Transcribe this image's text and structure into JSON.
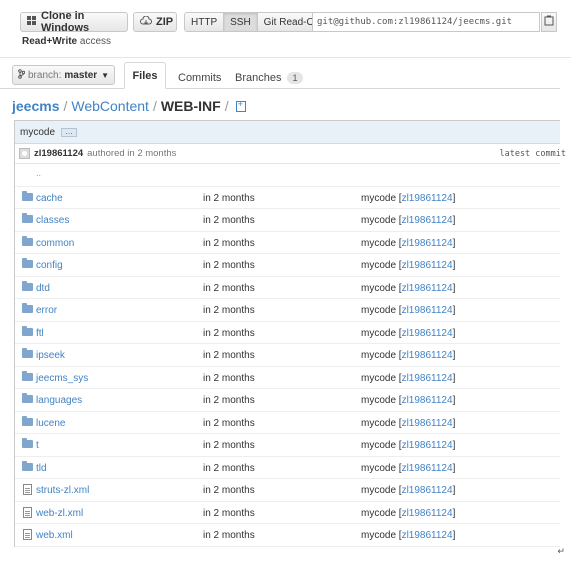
{
  "clone": {
    "clone_windows_label": "Clone in Windows",
    "zip_label": "ZIP",
    "protocols": [
      "HTTP",
      "SSH",
      "Git Read-Only"
    ],
    "active_protocol": "SSH",
    "url": "git@github.com:zl19861124/jeecms.git",
    "access_strong": "Read+Write",
    "access_rest": " access"
  },
  "tabs": {
    "branch_label": "branch:",
    "branch_value": "master",
    "files": "Files",
    "commits": "Commits",
    "branches": "Branches",
    "branches_count": "1"
  },
  "breadcrumb": {
    "repo": "jeecms",
    "sep": "/",
    "folder": "WebContent",
    "current": "WEB-INF"
  },
  "commit": {
    "title": "mycode",
    "dots": "…",
    "author": "zl19861124",
    "authored_text": "authored in 2 months",
    "latest": "latest commit"
  },
  "parent_dir": "..",
  "files": [
    {
      "name": "cache",
      "type": "dir",
      "age": "in 2 months",
      "message": "mycode",
      "committer": "zl19861124"
    },
    {
      "name": "classes",
      "type": "dir",
      "age": "in 2 months",
      "message": "mycode",
      "committer": "zl19861124"
    },
    {
      "name": "common",
      "type": "dir",
      "age": "in 2 months",
      "message": "mycode",
      "committer": "zl19861124"
    },
    {
      "name": "config",
      "type": "dir",
      "age": "in 2 months",
      "message": "mycode",
      "committer": "zl19861124"
    },
    {
      "name": "dtd",
      "type": "dir",
      "age": "in 2 months",
      "message": "mycode",
      "committer": "zl19861124"
    },
    {
      "name": "error",
      "type": "dir",
      "age": "in 2 months",
      "message": "mycode",
      "committer": "zl19861124"
    },
    {
      "name": "ftl",
      "type": "dir",
      "age": "in 2 months",
      "message": "mycode",
      "committer": "zl19861124"
    },
    {
      "name": "ipseek",
      "type": "dir",
      "age": "in 2 months",
      "message": "mycode",
      "committer": "zl19861124"
    },
    {
      "name": "jeecms_sys",
      "type": "dir",
      "age": "in 2 months",
      "message": "mycode",
      "committer": "zl19861124"
    },
    {
      "name": "languages",
      "type": "dir",
      "age": "in 2 months",
      "message": "mycode",
      "committer": "zl19861124"
    },
    {
      "name": "lucene",
      "type": "dir",
      "age": "in 2 months",
      "message": "mycode",
      "committer": "zl19861124"
    },
    {
      "name": "t",
      "type": "dir",
      "age": "in 2 months",
      "message": "mycode",
      "committer": "zl19861124"
    },
    {
      "name": "tld",
      "type": "dir",
      "age": "in 2 months",
      "message": "mycode",
      "committer": "zl19861124"
    },
    {
      "name": "struts-zl.xml",
      "type": "file",
      "age": "in 2 months",
      "message": "mycode",
      "committer": "zl19861124"
    },
    {
      "name": "web-zl.xml",
      "type": "file",
      "age": "in 2 months",
      "message": "mycode",
      "committer": "zl19861124"
    },
    {
      "name": "web.xml",
      "type": "file",
      "age": "in 2 months",
      "message": "mycode",
      "committer": "zl19861124"
    }
  ],
  "icons": {
    "clone": "windows-icon",
    "zip": "cloud-download-icon",
    "copy": "clipboard-icon",
    "branch": "branch-icon",
    "new_file": "new-file-icon",
    "dir": "folder-icon",
    "file": "file-icon"
  },
  "colors": {
    "link": "#4183c4",
    "folder": "#80a6cd",
    "commit_bar": "#e8f1f8"
  }
}
